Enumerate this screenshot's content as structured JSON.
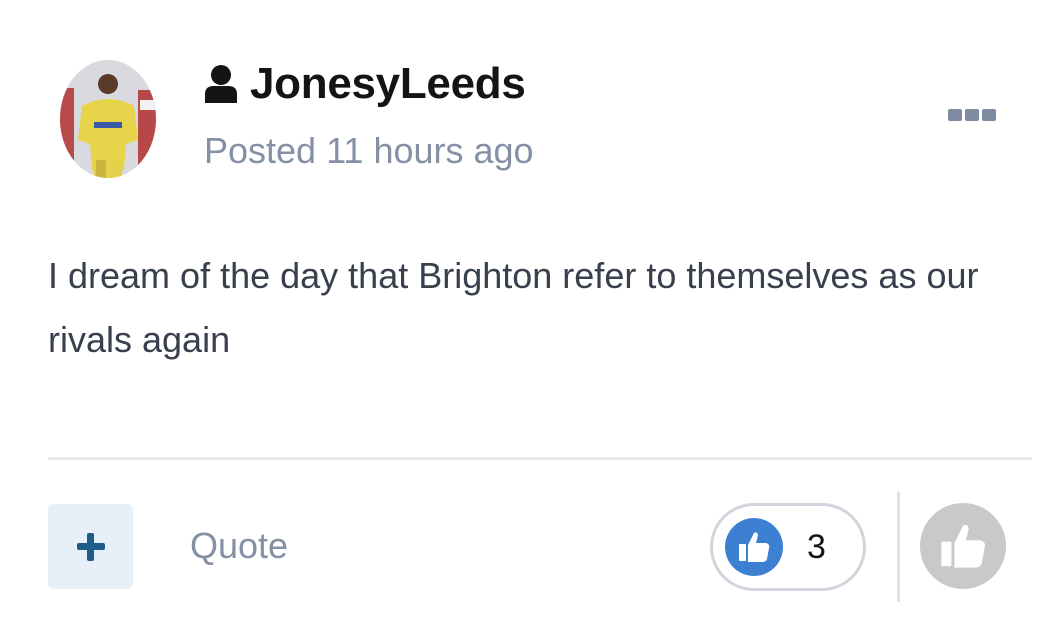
{
  "post": {
    "author": "JonesyLeeds",
    "posted": "Posted 11 hours ago",
    "content": "I dream of the day that Brighton refer to themselves as our rivals again"
  },
  "footer": {
    "quote_label": "Quote",
    "like_count": "3"
  },
  "icons": {
    "user": "user-icon",
    "more": "ellipsis-icon",
    "add": "plus-icon",
    "like": "thumbs-up-icon",
    "react": "thumbs-up-icon"
  },
  "colors": {
    "like_blue": "#3d7fd1",
    "muted_text": "#8690a4",
    "add_button_bg": "#e7f0f8",
    "add_button_fg": "#1e5c8c",
    "react_grey": "#c9c9cc"
  }
}
